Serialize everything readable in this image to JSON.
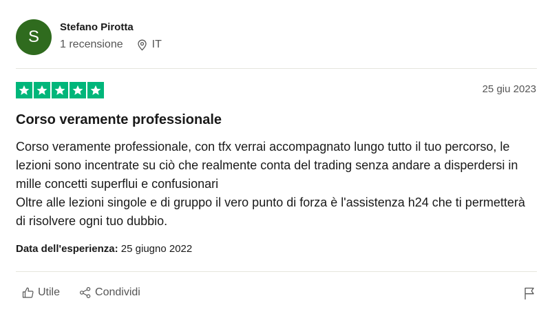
{
  "reviewer": {
    "initial": "S",
    "name": "Stefano Pirotta",
    "reviews_count": "1 recensione",
    "country": "IT",
    "avatar_color": "#2f6b1e"
  },
  "review": {
    "rating": 5,
    "max_rating": 5,
    "star_color": "#00b67a",
    "date": "25 giu 2023",
    "title": "Corso veramente professionale",
    "body_lines": [
      "Corso veramente professionale, con tfx verrai accompagnato lungo tutto il tuo percorso, le lezioni sono incentrate su ciò che realmente conta del trading senza andare a disperdersi in mille concetti superflui e confusionari",
      "Oltre alle lezioni singole e di gruppo il vero punto di forza è l'assistenza h24 che ti permetterà di risolvere ogni tuo dubbio."
    ],
    "experience_label": "Data dell'esperienza:",
    "experience_date": "25 giugno 2022"
  },
  "actions": {
    "useful_label": "Utile",
    "share_label": "Condividi",
    "useful_icon": "thumbs-up-icon",
    "share_icon": "share-icon",
    "report_icon": "flag-icon"
  }
}
